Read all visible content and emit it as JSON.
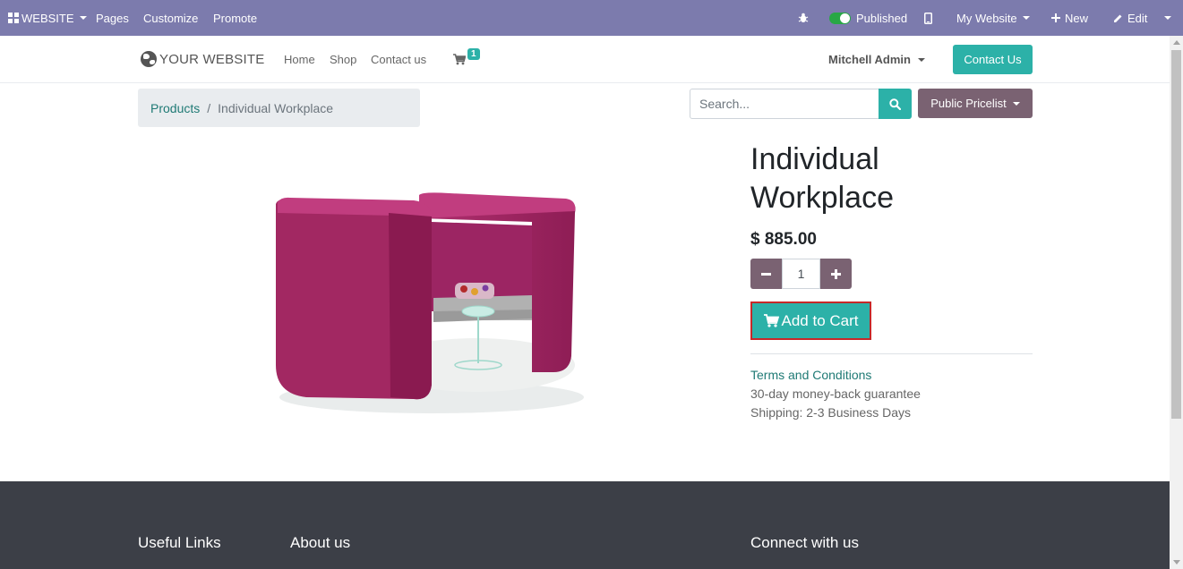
{
  "adminbar": {
    "app_menu": "WEBSITE",
    "pages": "Pages",
    "customize": "Customize",
    "promote": "Promote",
    "published": "Published",
    "my_website": "My Website",
    "new": "New",
    "edit": "Edit",
    "color": "#7c7bad"
  },
  "header": {
    "logo_text": "YOUR WEBSITE",
    "nav": [
      "Home",
      "Shop",
      "Contact us"
    ],
    "cart_count": "1",
    "user": "Mitchell Admin",
    "contact_button": "Contact Us",
    "accent": "#2cb1a8"
  },
  "breadcrumb": {
    "parent": "Products",
    "separator": "/",
    "current": "Individual Workplace"
  },
  "search": {
    "placeholder": "Search...",
    "icon": "search-icon"
  },
  "pricelist": "Public Pricelist",
  "product": {
    "title_line1": "Individual",
    "title_line2": "Workplace",
    "price": "$ 885.00",
    "quantity": "1",
    "add_to_cart": "Add to Cart",
    "terms": "Terms and Conditions",
    "guarantee": "30-day money-back guarantee",
    "shipping": "Shipping: 2-3 Business Days",
    "image_alt": "Individual Workplace"
  },
  "footer": {
    "useful_links": "Useful Links",
    "about_us": "About us",
    "connect": "Connect with us"
  }
}
